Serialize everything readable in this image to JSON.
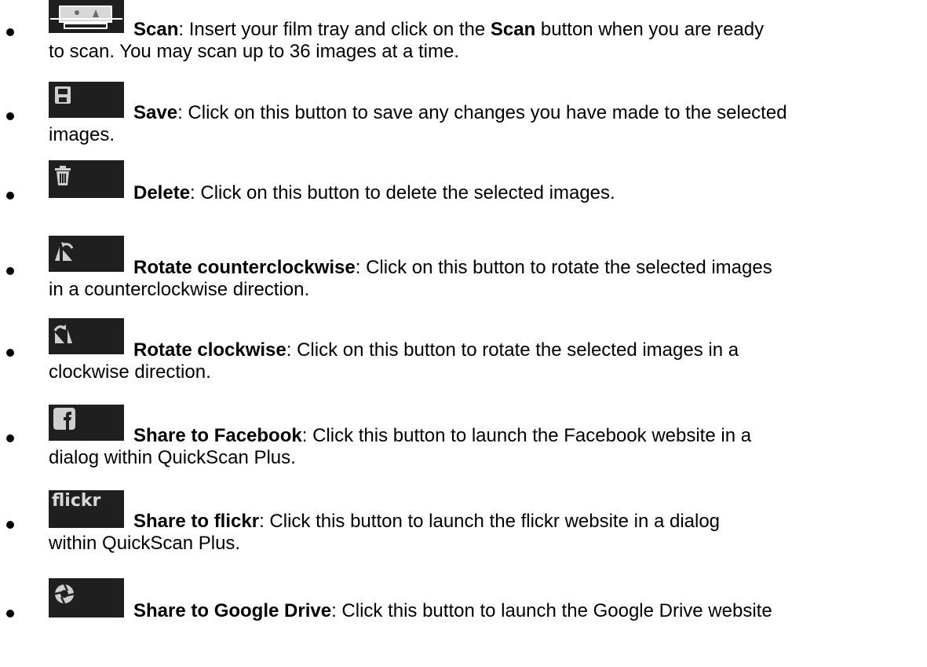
{
  "items": [
    {
      "icon": "scan-icon",
      "title": "Scan",
      "text_a": ": Insert your film tray and click on the ",
      "bold_inline": "Scan",
      "text_b": " button when you are ready",
      "line2": "to scan. You may scan up to 36 images at a time."
    },
    {
      "icon": "save-icon",
      "title": "Save",
      "text_a": ": Click on this button to save any changes you have made to the selected",
      "line2": "images."
    },
    {
      "icon": "trash-icon",
      "title": "Delete",
      "text_a": ": Click on this button to delete the selected images."
    },
    {
      "icon": "rotate-counterclockwise-icon",
      "title": "Rotate counterclockwise",
      "text_a": ": Click on this button to rotate the selected images",
      "line2": "in a counterclockwise direction."
    },
    {
      "icon": "rotate-clockwise-icon",
      "title": "Rotate clockwise",
      "text_a": ": Click on this button to rotate the selected images in a",
      "line2": "clockwise direction."
    },
    {
      "icon": "facebook-icon",
      "title": "Share to Facebook",
      "text_a": ": Click this button to launch the Facebook website in a",
      "line2": "dialog within QuickScan Plus."
    },
    {
      "icon": "flickr-icon",
      "icon_text": "flickr",
      "title": "Share to flickr",
      "text_a": ": Click this button to launch the flickr website in a dialog",
      "line2": "within QuickScan Plus."
    },
    {
      "icon": "google-drive-icon",
      "title": "Share to Google Drive",
      "text_a": ": Click this button to launch the Google Drive website"
    }
  ]
}
